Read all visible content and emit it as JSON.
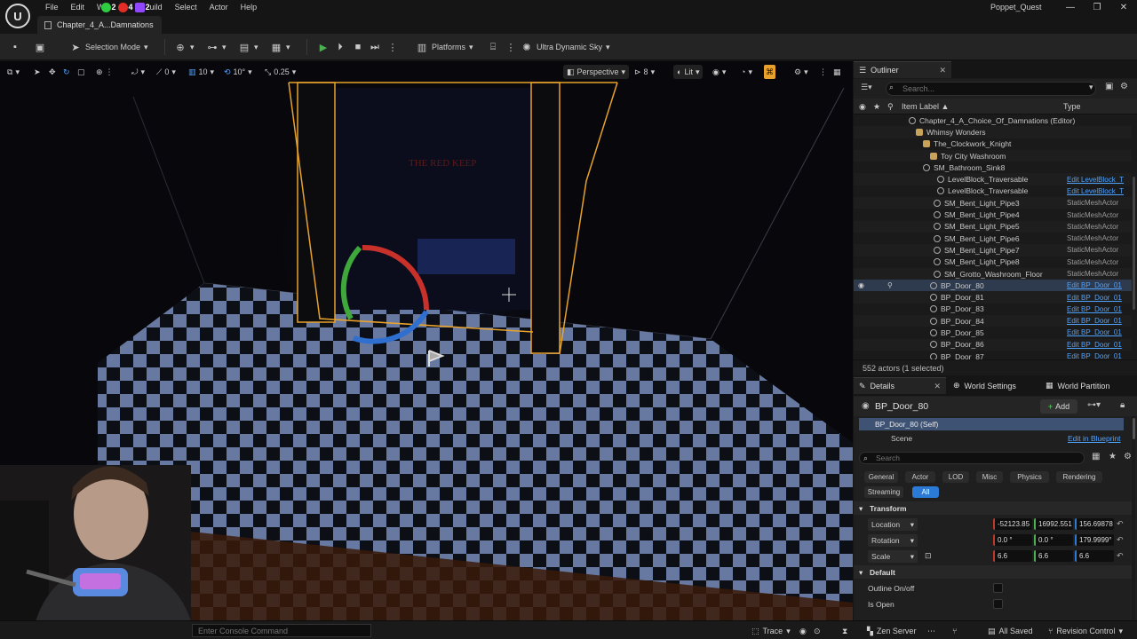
{
  "menu": {
    "items": [
      "File",
      "Edit",
      "Wi",
      "uild",
      "Select",
      "Actor",
      "Help"
    ],
    "badges": [
      {
        "count": "2",
        "color": "#2ecc40"
      },
      {
        "count": "4",
        "color": "#e52d27"
      },
      {
        "count": "2",
        "color": "#9146ff"
      }
    ]
  },
  "project_name": "Poppet_Quest",
  "level_tab": "Chapter_4_A...Damnations",
  "toolbar": {
    "selection_mode": "Selection Mode",
    "platforms": "Platforms",
    "sky": "Ultra Dynamic Sky"
  },
  "viewport": {
    "snap_rotation_value": "0",
    "grid_size": "10",
    "rotation_snap": "10°",
    "scale_snap": "0.25",
    "perspective": "Perspective",
    "camera_speed": "8",
    "lit": "Lit",
    "sign_text": "THE RED KEEP"
  },
  "console": {
    "placeholder": "Enter Console Command",
    "trace": "Trace",
    "zen_server": "Zen Server",
    "all_saved": "All Saved",
    "revision_control": "Revision Control"
  },
  "outliner": {
    "tab": "Outliner",
    "search_placeholder": "Search...",
    "col_label": "Item Label ▲",
    "col_type": "Type",
    "rows": [
      {
        "label": "Chapter_4_A_Choice_Of_Damnations (Editor)",
        "type": "",
        "indent": 1,
        "icon": "level",
        "link": false
      },
      {
        "label": "Whimsy Wonders",
        "type": "",
        "indent": 2,
        "icon": "folder",
        "link": false
      },
      {
        "label": "The_Clockwork_Knight",
        "type": "",
        "indent": 3,
        "icon": "folder",
        "link": false
      },
      {
        "label": "Toy City Washroom",
        "type": "",
        "indent": 4,
        "icon": "folder",
        "link": false
      },
      {
        "label": "SM_Bathroom_Sink8",
        "type": "",
        "indent": 3,
        "icon": "mesh",
        "link": false
      },
      {
        "label": "LevelBlock_Traversable",
        "type": "Edit LevelBlock_T",
        "indent": 5,
        "icon": "mesh",
        "link": true
      },
      {
        "label": "LevelBlock_Traversable",
        "type": "Edit LevelBlock_T",
        "indent": 5,
        "icon": "mesh",
        "link": true
      },
      {
        "label": "SM_Bent_Light_Pipe3",
        "type": "StaticMeshActor",
        "indent": 4.5,
        "icon": "mesh",
        "link": false
      },
      {
        "label": "SM_Bent_Light_Pipe4",
        "type": "StaticMeshActor",
        "indent": 4.5,
        "icon": "mesh",
        "link": false
      },
      {
        "label": "SM_Bent_Light_Pipe5",
        "type": "StaticMeshActor",
        "indent": 4.5,
        "icon": "mesh",
        "link": false
      },
      {
        "label": "SM_Bent_Light_Pipe6",
        "type": "StaticMeshActor",
        "indent": 4.5,
        "icon": "mesh",
        "link": false
      },
      {
        "label": "SM_Bent_Light_Pipe7",
        "type": "StaticMeshActor",
        "indent": 4.5,
        "icon": "mesh",
        "link": false
      },
      {
        "label": "SM_Bent_Light_Pipe8",
        "type": "StaticMeshActor",
        "indent": 4.5,
        "icon": "mesh",
        "link": false
      },
      {
        "label": "SM_Grotto_Washroom_Floor",
        "type": "StaticMeshActor",
        "indent": 4.5,
        "icon": "mesh",
        "link": false
      },
      {
        "label": "BP_Door_80",
        "type": "Edit BP_Door_01",
        "indent": 4,
        "icon": "mesh",
        "link": true,
        "selected": true
      },
      {
        "label": "BP_Door_81",
        "type": "Edit BP_Door_01",
        "indent": 4,
        "icon": "mesh",
        "link": true
      },
      {
        "label": "BP_Door_83",
        "type": "Edit BP_Door_01",
        "indent": 4,
        "icon": "mesh",
        "link": true
      },
      {
        "label": "BP_Door_84",
        "type": "Edit BP_Door_01",
        "indent": 4,
        "icon": "mesh",
        "link": true
      },
      {
        "label": "BP_Door_85",
        "type": "Edit BP_Door_01",
        "indent": 4,
        "icon": "mesh",
        "link": true
      },
      {
        "label": "BP_Door_86",
        "type": "Edit BP_Door_01",
        "indent": 4,
        "icon": "mesh",
        "link": true
      },
      {
        "label": "BP_Door_87",
        "type": "Edit BP_Door_01",
        "indent": 4,
        "icon": "mesh",
        "link": true
      }
    ],
    "footer": "552 actors (1 selected)"
  },
  "details": {
    "tabs": [
      "Details",
      "World Settings",
      "World Partition"
    ],
    "title": "BP_Door_80",
    "add": "Add",
    "component_self": "BP_Door_80 (Self)",
    "component_scene": "Scene",
    "edit_in_blueprint": "Edit in Blueprint",
    "search_placeholder": "Search",
    "filters": [
      "General",
      "Actor",
      "LOD",
      "Misc",
      "Physics",
      "Rendering",
      "Streaming",
      "All"
    ],
    "active_filter": "All",
    "transform_section": "Transform",
    "location_label": "Location",
    "location": [
      "-52123.85",
      "16992.551",
      "156.69878"
    ],
    "rotation_label": "Rotation",
    "rotation": [
      "0.0 °",
      "0.0 °",
      "179.9999°"
    ],
    "scale_label": "Scale",
    "scale": [
      "6.6",
      "6.6",
      "6.6"
    ],
    "default_section": "Default",
    "outline_label": "Outline On/off",
    "is_open_label": "Is Open"
  },
  "colors": {
    "accent": "#2a7ad6",
    "selection_outline": "#e8a22b",
    "link": "#4fa3ff"
  }
}
